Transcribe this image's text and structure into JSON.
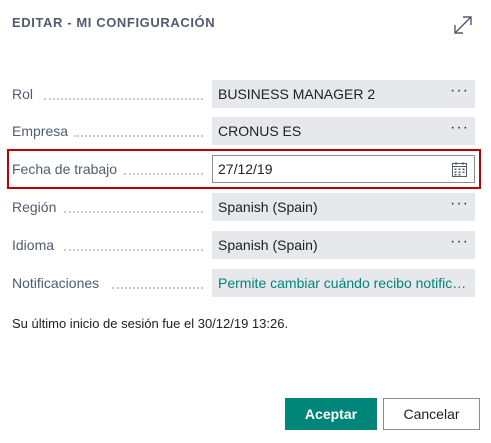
{
  "dialog": {
    "title": "EDITAR - MI CONFIGURACIÓN",
    "expand_icon": "expand-arrows-icon"
  },
  "fields": {
    "rol": {
      "label": "Rol",
      "value": "BUSINESS MANAGER 2",
      "more": "···"
    },
    "empresa": {
      "label": "Empresa",
      "value": "CRONUS ES",
      "more": "···"
    },
    "fecha": {
      "label": "Fecha de trabajo",
      "value": "27/12/19",
      "icon": "calendar-icon"
    },
    "region": {
      "label": "Región",
      "value": "Spanish (Spain)",
      "more": "···"
    },
    "idioma": {
      "label": "Idioma",
      "value": "Spanish (Spain)",
      "more": "···"
    },
    "notificaciones": {
      "label": "Notificaciones",
      "value": "Permite cambiar cuándo recibo notificaciones."
    }
  },
  "last_login": "Su último inicio de sesión fue el 30/12/19 13:26.",
  "buttons": {
    "accept": "Aceptar",
    "cancel": "Cancelar"
  },
  "colors": {
    "accent": "#00857a",
    "highlight_border": "#c00000",
    "field_bg": "#e6e8eb"
  }
}
